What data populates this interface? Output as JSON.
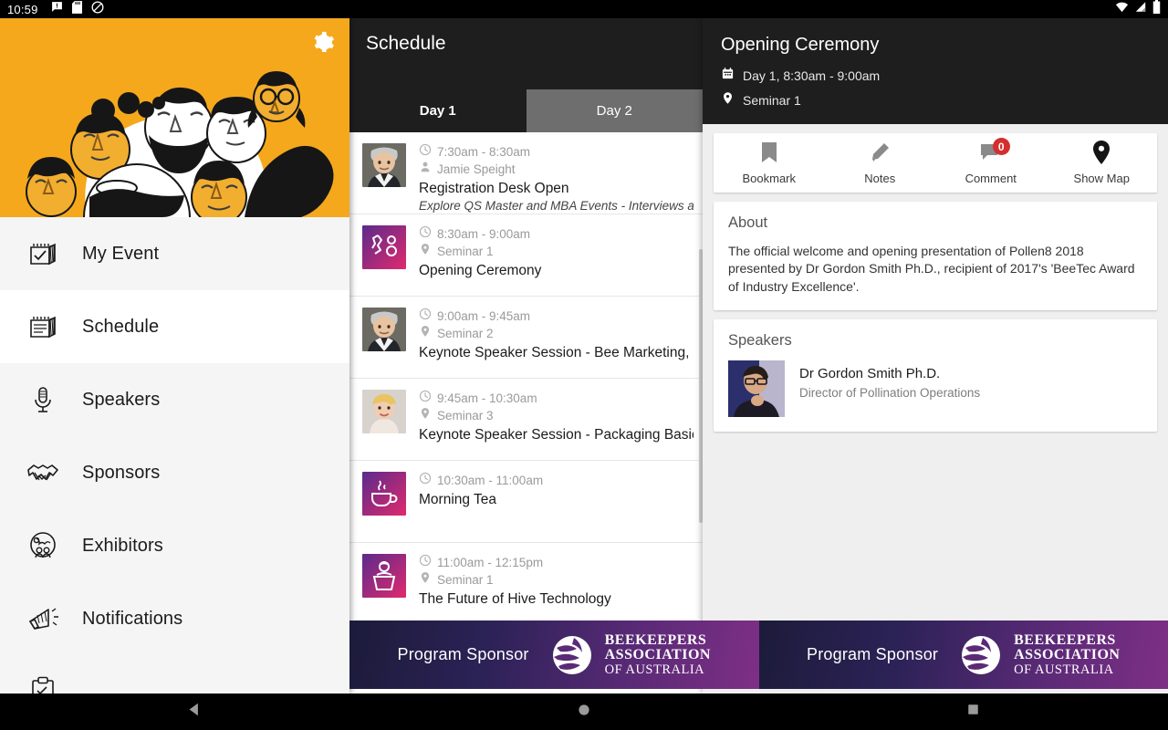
{
  "statusbar": {
    "time": "10:59",
    "icons": [
      "message-alert-icon",
      "sd-card-icon",
      "do-not-disturb-icon",
      "wifi-icon",
      "signal-icon",
      "battery-icon"
    ]
  },
  "drawer": {
    "settings_label": "gear-icon",
    "items": [
      {
        "label": "My Event",
        "icon": "calendar-check-icon",
        "active": false
      },
      {
        "label": "Schedule",
        "icon": "calendar-lines-icon",
        "active": true
      },
      {
        "label": "Speakers",
        "icon": "microphone-icon",
        "active": false
      },
      {
        "label": "Sponsors",
        "icon": "handshake-icon",
        "active": false
      },
      {
        "label": "Exhibitors",
        "icon": "globe-people-icon",
        "active": false
      },
      {
        "label": "Notifications",
        "icon": "megaphone-icon",
        "active": false
      },
      {
        "label": "",
        "icon": "clipboard-icon",
        "active": false
      }
    ]
  },
  "schedule": {
    "title": "Schedule",
    "tabs": [
      {
        "label": "Day 1",
        "active": true
      },
      {
        "label": "Day 2",
        "active": false,
        "pressed": true
      }
    ],
    "items": [
      {
        "time": "7:30am - 8:30am",
        "meta2_icon": "person-icon",
        "meta2": "Jamie Speight",
        "title": "Registration Desk Open",
        "subtitle": "Explore QS Master and MBA Events - Interviews and ",
        "thumb": "photo-man-grey"
      },
      {
        "time": "8:30am - 9:00am",
        "meta2_icon": "location-icon",
        "meta2": "Seminar 1",
        "title": "Opening Ceremony",
        "subtitle": "",
        "thumb": "icon-ceremony"
      },
      {
        "time": "9:00am - 9:45am",
        "meta2_icon": "location-icon",
        "meta2": "Seminar 2",
        "title": "Keynote Speaker Session - Bee Marketing, Be",
        "subtitle": "",
        "thumb": "photo-man-grey"
      },
      {
        "time": "9:45am - 10:30am",
        "meta2_icon": "location-icon",
        "meta2": "Seminar 3",
        "title": "Keynote Speaker Session - Packaging Basics",
        "subtitle": "",
        "thumb": "photo-woman-blonde"
      },
      {
        "time": "10:30am - 11:00am",
        "meta2_icon": "",
        "meta2": "",
        "title": "Morning Tea",
        "subtitle": "",
        "thumb": "icon-tea"
      },
      {
        "time": "11:00am - 12:15pm",
        "meta2_icon": "location-icon",
        "meta2": "Seminar 1",
        "title": "The Future of Hive Technology",
        "subtitle": "",
        "thumb": "icon-lectern"
      }
    ]
  },
  "detail": {
    "title": "Opening Ceremony",
    "date_time": "Day 1, 8:30am - 9:00am",
    "location": "Seminar 1",
    "actions": [
      {
        "label": "Bookmark",
        "icon": "bookmark-icon",
        "badge": null
      },
      {
        "label": "Notes",
        "icon": "pencil-icon",
        "badge": null
      },
      {
        "label": "Comment",
        "icon": "comment-icon",
        "badge": "0"
      },
      {
        "label": "Show Map",
        "icon": "map-pin-icon",
        "badge": null
      }
    ],
    "about": {
      "heading": "About",
      "text": "The official welcome and opening presentation of Pollen8 2018 presented by Dr Gordon Smith Ph.D., recipient of 2017's 'BeeTec Award of Industry Excellence'."
    },
    "speakers": {
      "heading": "Speakers",
      "list": [
        {
          "name": "Dr Gordon Smith Ph.D.",
          "role": "Director of Pollination Operations"
        }
      ]
    }
  },
  "sponsor": {
    "label": "Program Sponsor",
    "logo_line1": "BEEKEEPERS",
    "logo_line2": "ASSOCIATION",
    "logo_line3": "OF AUSTRALIA"
  },
  "navbar": {
    "back": "back-triangle-icon",
    "home": "home-circle-icon",
    "recents": "recents-square-icon"
  },
  "colors": {
    "accent_orange": "#f5a81c",
    "appbar_dark": "#1e1e1e",
    "badge_red": "#d32f2f",
    "page_bg": "#efefef"
  }
}
